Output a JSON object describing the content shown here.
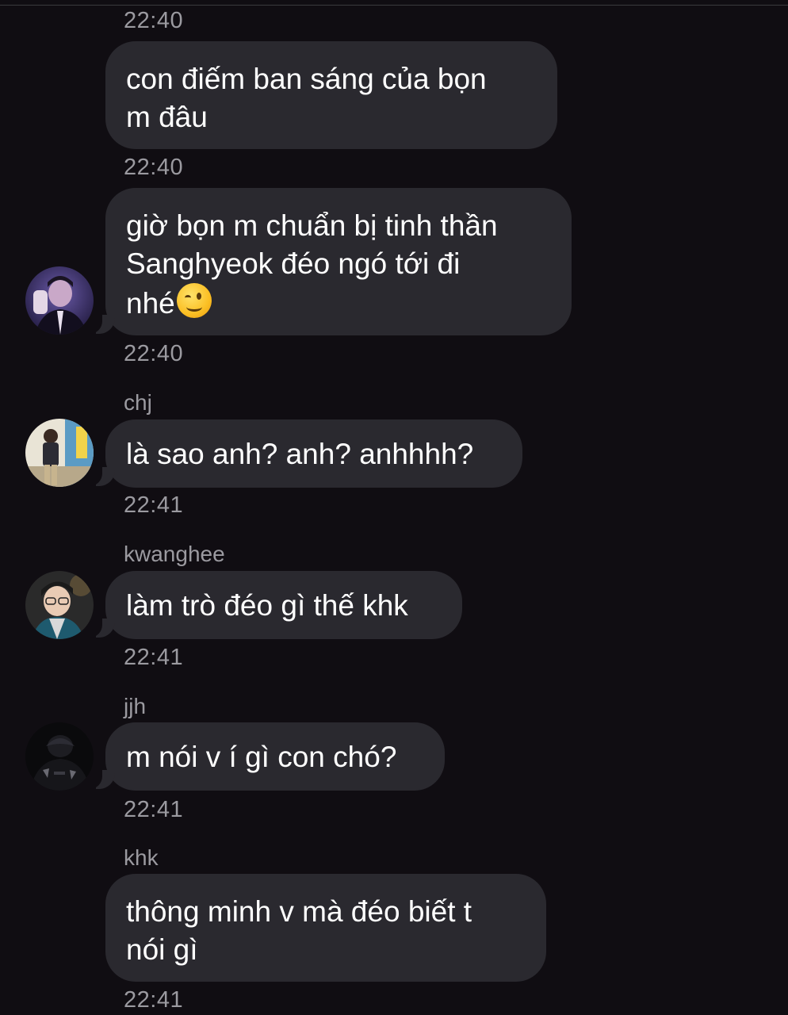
{
  "messages": [
    {
      "time_before": "22:40",
      "sender": "",
      "text": [
        "con điếm ban sáng của bọn",
        "m đâu"
      ]
    },
    {
      "time_before": "22:40",
      "sender": "",
      "text": [
        "giờ bọn m chuẩn bị tinh thần",
        "Sanghyeok đéo ngó tới đi",
        "nhé"
      ],
      "emoji": "winking-face"
    },
    {
      "time_before": "22:40",
      "sender": "chj",
      "text": [
        "là sao anh? anh? anhhhh?"
      ]
    },
    {
      "time_before": "22:41",
      "sender": "kwanghee",
      "text": [
        "làm trò đéo gì thế khk"
      ]
    },
    {
      "time_before": "22:41",
      "sender": "jjh",
      "text": [
        "m nói v í gì con chó?"
      ]
    },
    {
      "time_before": "22:41",
      "sender": "khk",
      "text": [
        "thông minh v mà đéo biết t",
        "nói gì"
      ]
    }
  ],
  "last_time": "22:41",
  "colors": {
    "background": "#100d12",
    "bubble": "#2a292f",
    "meta_text": "#9b9aa0",
    "message_text": "#ffffff"
  }
}
